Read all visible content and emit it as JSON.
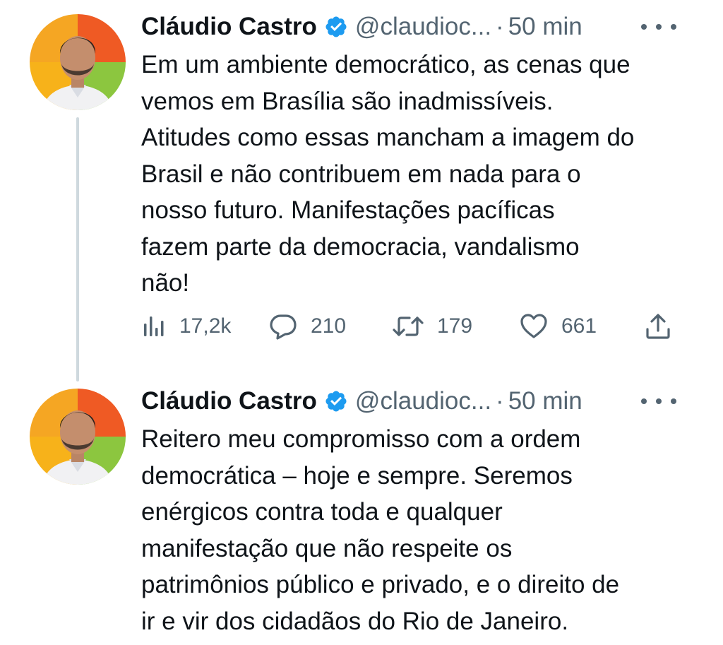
{
  "tweets": [
    {
      "author_name": "Cláudio Castro",
      "handle": "@claudioc...",
      "separator": "·",
      "time": "50 min",
      "text": "Em um ambiente democrático, as cenas que\nvemos em Brasília são inadmissíveis.\nAtitudes como essas mancham a imagem do\nBrasil e não contribuem em nada para o\nnosso futuro. Manifestações pacíficas\nfazem parte da democracia, vandalismo\nnão!",
      "views": "17,2k",
      "replies": "210",
      "retweets": "179",
      "likes": "661"
    },
    {
      "author_name": "Cláudio Castro",
      "handle": "@claudioc...",
      "separator": "·",
      "time": "50 min",
      "text": "Reitero meu compromisso com a ordem\ndemocrática – hoje e sempre. Seremos\nenérgicos contra toda e qualquer\nmanifestação que não respeite os\npatrimônios público e privado, e o direito de\nir e vir dos cidadãos do Rio de Janeiro."
    }
  ],
  "colors": {
    "text": "#0f1419",
    "secondary": "#536471",
    "verified": "#1d9bf0",
    "thread_line": "#cfd9de"
  },
  "icons": {
    "verified": "verified-badge-icon",
    "more": "more-icon",
    "views": "views-icon",
    "reply": "reply-icon",
    "retweet": "retweet-icon",
    "like": "like-icon",
    "share": "share-icon"
  }
}
